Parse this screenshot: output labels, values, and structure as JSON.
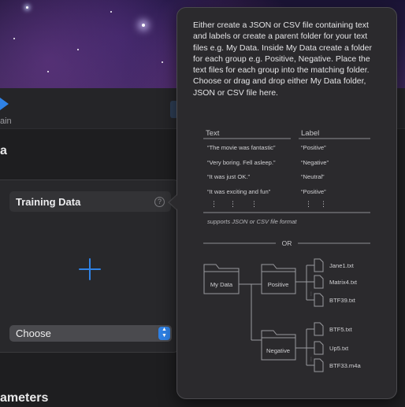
{
  "toolbar": {
    "train_label": "ain"
  },
  "section_data_title": "a",
  "training_data": {
    "title": "Training Data",
    "help_glyph": "?",
    "choose_label": "Choose",
    "stepper_up": "▲",
    "stepper_down": "▼"
  },
  "section_params_title": "ameters",
  "popover": {
    "description": "Either create a JSON or CSV file containing text and labels or create a parent folder for your text files e.g. My Data. Inside My Data create a folder for each group e.g. Positive, Negative. Place the text files for each group into the matching folder. Choose or drag and drop either My Data folder, JSON or CSV file here.",
    "table": {
      "headers": [
        "Text",
        "Label"
      ],
      "rows": [
        [
          "“The movie was fantastic”",
          "“Positive”"
        ],
        [
          "“Very boring. Fell asleep.”",
          "“Negative”"
        ],
        [
          "“It was just OK.”",
          "“Neutral”"
        ],
        [
          "“It was exciting and fun”",
          "“Positive”"
        ]
      ],
      "ellipsis": "⋮",
      "footnote": "supports JSON or CSV file format"
    },
    "or_label": "OR",
    "tree": {
      "root": "My Data",
      "groups": [
        {
          "name": "Positive",
          "files": [
            "Jane1.txt",
            "Matrix4.txt",
            "BTF39.txt"
          ]
        },
        {
          "name": "Negative",
          "files": [
            "BTF5.txt",
            "Up5.txt",
            "BTF33.m4a"
          ]
        }
      ]
    }
  },
  "colors": {
    "accent": "#2f82e6",
    "popover_bg": "#2b2a2d",
    "diagram_line": "#8e8e92"
  }
}
